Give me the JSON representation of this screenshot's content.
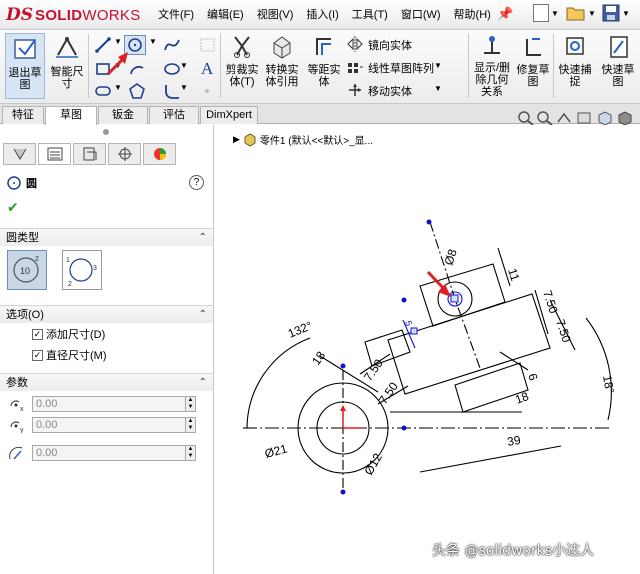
{
  "brand": {
    "ds": "DS",
    "name_bold": "SOLID",
    "name_thin": "WORKS"
  },
  "menu": [
    "文件(F)",
    "编辑(E)",
    "视图(V)",
    "插入(I)",
    "工具(T)",
    "窗口(W)",
    "帮助(H)"
  ],
  "toolbar": {
    "exit_sketch": "退出草图",
    "smart_dimension": "智能尺寸",
    "trim_entities": "剪裁实体(T)",
    "convert_entities": "转换实体引用",
    "offset_entities": "等距实体",
    "mirror_entities": "镜向实体",
    "linear_pattern": "线性草图阵列",
    "move_entities": "移动实体",
    "display_relations": "显示/删除几何关系",
    "repair_sketch": "修复草图",
    "quick_snaps": "快速捕捉",
    "rapid_sketch": "快速草图"
  },
  "tabs": [
    "特征",
    "草图",
    "钣金",
    "评估",
    "DimXpert"
  ],
  "active_tab": "草图",
  "tree": {
    "part_label": "零件1 (默认<<默认>_显..."
  },
  "property_manager": {
    "title": "圆",
    "circle_type_section": "圆类型",
    "options_section": "选项(O)",
    "add_dimension": "添加尺寸(D)",
    "diameter_dimension": "直径尺寸(M)",
    "params_section": "参数",
    "param_x": "0.00",
    "param_y": "0.00",
    "param_r": "0.00",
    "help": "?"
  },
  "drawing": {
    "angle_132": "132°",
    "angle_18": "18°",
    "dia_8": "Ø8",
    "dia_21": "Ø21",
    "dia_12": "Ø12",
    "dim_11": "11",
    "dim_7_50_a": "7.50",
    "dim_7_50_b": "7.50",
    "dim_7_50_c": "7.50",
    "dim_7_50_d": "7.50",
    "dim_18_a": "18",
    "dim_18_b": "18",
    "dim_6": "6",
    "dim_39": "39",
    "dim_5": "5"
  },
  "watermark": "头条 @solidworks小达人",
  "colors": {
    "brand_red": "#c8102e",
    "sketch_blue": "#1010d0",
    "sketch_black": "#000000"
  }
}
